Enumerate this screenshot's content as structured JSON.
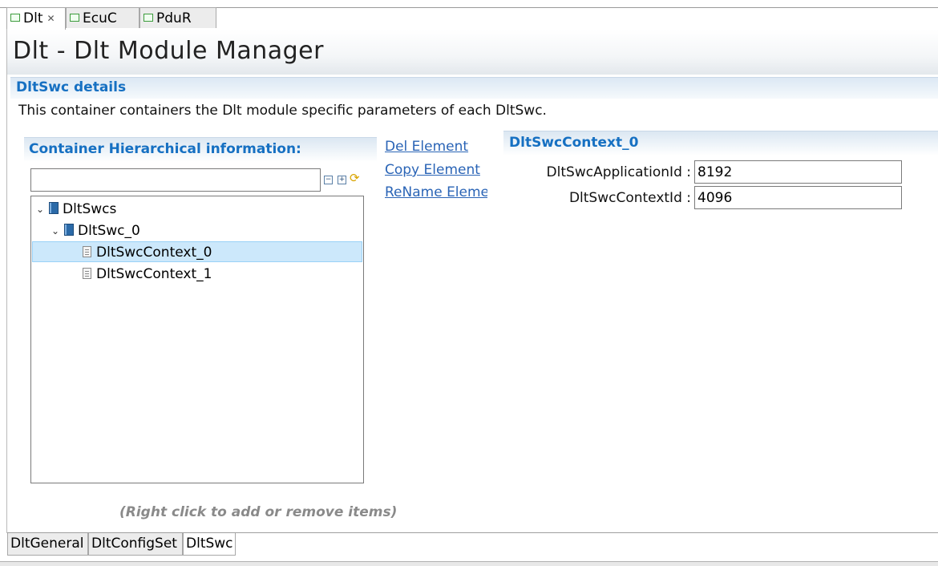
{
  "editor_tabs": [
    {
      "label": "Dlt",
      "active": true,
      "closable": true
    },
    {
      "label": "EcuC",
      "active": false,
      "closable": false
    },
    {
      "label": "PduR",
      "active": false,
      "closable": false
    }
  ],
  "header": {
    "title": "Dlt - Dlt Module Manager"
  },
  "section": {
    "title": "DltSwc details",
    "description": "This container containers the Dlt module specific parameters of each DltSwc."
  },
  "hierarchy": {
    "title": "Container Hierarchical information:",
    "filter_value": "",
    "hint": "(Right click to add or remove items)",
    "tree": [
      {
        "label": "DltSwcs",
        "level": 0,
        "icon": "container-book-icon",
        "expanded": true,
        "selected": false
      },
      {
        "label": "DltSwc_0",
        "level": 1,
        "icon": "container-book-icon",
        "expanded": true,
        "selected": false
      },
      {
        "label": "DltSwcContext_0",
        "level": 2,
        "icon": "document-icon",
        "selected": true
      },
      {
        "label": "DltSwcContext_1",
        "level": 2,
        "icon": "document-icon",
        "selected": false
      }
    ]
  },
  "actions": {
    "del": "Del Element",
    "copy": "Copy Element",
    "rename": "ReName Element"
  },
  "details": {
    "title": "DltSwcContext_0",
    "fields": [
      {
        "label": "DltSwcApplicationId :",
        "value": "8192"
      },
      {
        "label": "DltSwcContextId :",
        "value": "4096"
      }
    ]
  },
  "page_tabs": [
    {
      "label": "DltGeneral",
      "active": false
    },
    {
      "label": "DltConfigSet",
      "active": false
    },
    {
      "label": "DltSwc",
      "active": true
    }
  ],
  "colors": {
    "section_title": "#1670c2",
    "link": "#2a64b6",
    "selection": "#cce8fb",
    "hint": "#8a8a8a"
  }
}
